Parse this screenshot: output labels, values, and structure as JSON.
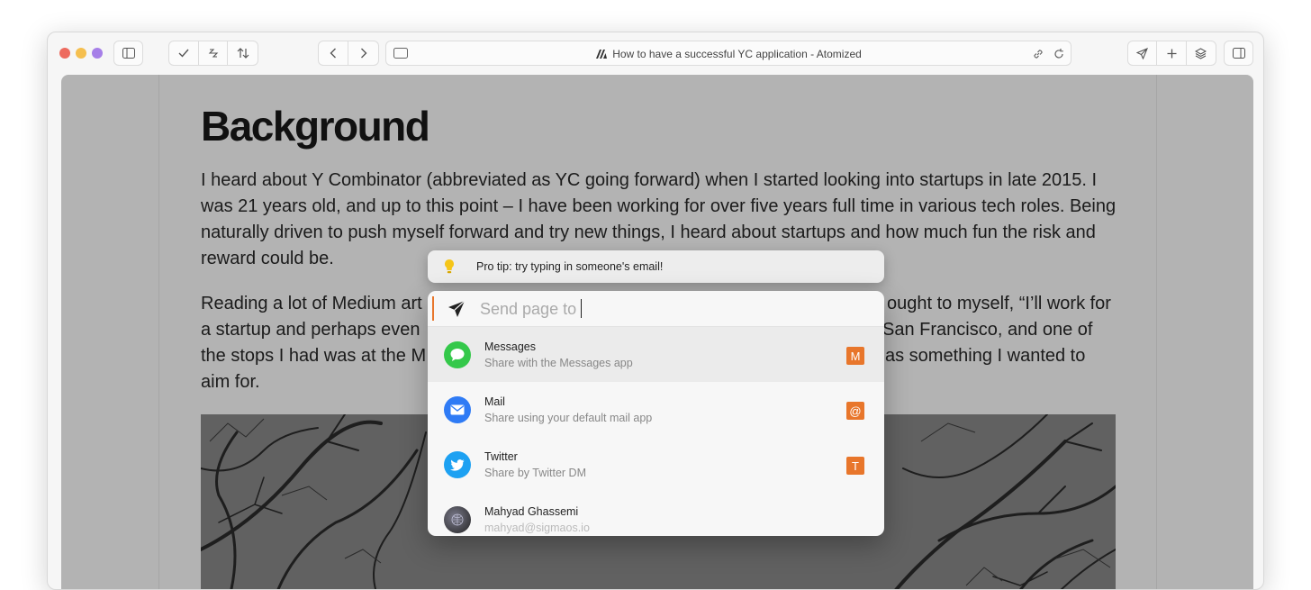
{
  "window": {
    "traffic_colors": [
      "#ed6a5e",
      "#f5bf4f",
      "#a67fe8"
    ]
  },
  "toolbar": {
    "page_title": "How to have a successful YC application - Atomized"
  },
  "article": {
    "heading": "Background",
    "paragraph_1": "I heard about Y Combinator (abbreviated as YC going forward) when I started looking into startups in late 2015. I was 21 years old, and up to this point – I have been working for over five years full time in various tech roles. Being naturally driven to push myself forward and try new things, I heard about startups and how much fun the risk and reward could be.",
    "paragraph_2": "Reading a lot of Medium articles and blog posts about startups, and after a while I thought to myself, “I’ll work for a startup and perhaps even found one someday.” In 2016 I took a trip to San Francisco, and one of the stops I had was at the M[...] as something I wanted to aim for.",
    "paragraph_2_visible": {
      "line1_left": "Reading a lot of Medium art",
      "line1_right": "ought to myself, “I’ll work for",
      "line2_left": "a startup and perhaps even",
      "line2_right": "San Francisco, and one of",
      "line3_left": "the stops I had was at the M",
      "line3_right": "as something I wanted to",
      "line4_left": "aim for."
    }
  },
  "protip": {
    "text": "Pro tip: try typing in someone's email!",
    "icon": "lightbulb-icon"
  },
  "send_panel": {
    "placeholder": "Send page to",
    "accent_color": "#e8762b",
    "items": [
      {
        "title": "Messages",
        "subtitle": "Share with the Messages app",
        "shortcut": "M",
        "icon": "messages-icon",
        "icon_color": "#34c84a"
      },
      {
        "title": "Mail",
        "subtitle": "Share using your default mail app",
        "shortcut": "@",
        "icon": "mail-icon",
        "icon_color": "#2f7bf5"
      },
      {
        "title": "Twitter",
        "subtitle": "Share by Twitter DM",
        "shortcut": "T",
        "icon": "twitter-icon",
        "icon_color": "#1da1f2"
      },
      {
        "title": "Mahyad Ghassemi",
        "subtitle": "mahyad@sigmaos.io",
        "shortcut": "",
        "icon": "avatar",
        "icon_color": "#333333"
      }
    ]
  }
}
